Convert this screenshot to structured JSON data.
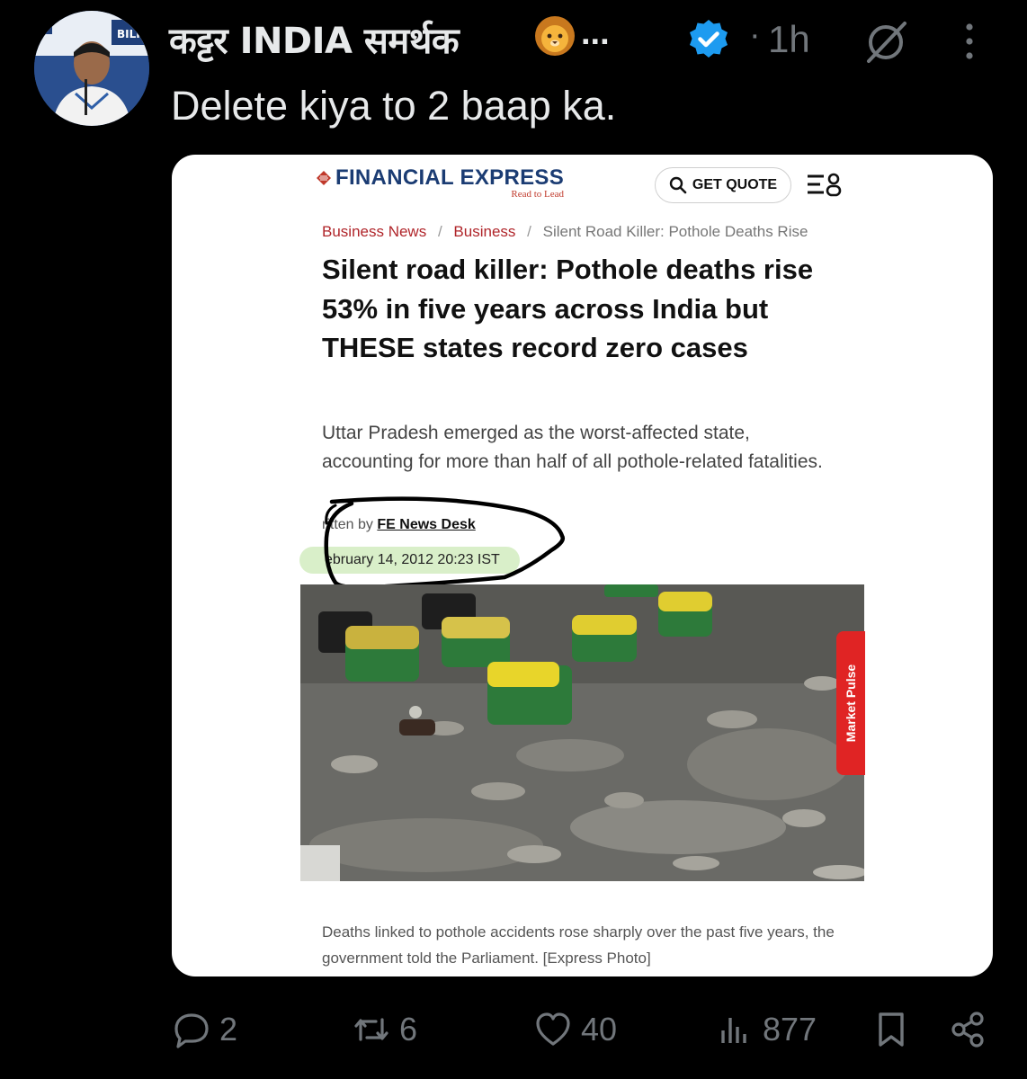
{
  "post": {
    "author_name": "कट्टर INDIA समर्थक",
    "name_truncation": "...",
    "separator": "·",
    "time_ago": "1h",
    "text": "Delete kiya to 2 baap ka."
  },
  "embedded_article": {
    "logo_name": "FINANCIAL EXPRESS",
    "logo_tagline": "Read to Lead",
    "get_quote_label": "GET QUOTE",
    "breadcrumbs": [
      "Business News",
      "Business",
      "Silent Road Killer: Pothole Deaths Rise"
    ],
    "breadcrumb_sep": "/",
    "headline": "Silent road killer: Pothole deaths rise 53% in five years across India but THESE states record zero cases",
    "summary": "Uttar Pradesh emerged as the worst-affected state, accounting for more than half of all pothole-related fatalities.",
    "byline_prefix": "ritten by",
    "author": "FE News Desk",
    "date": "ebruary 14, 2012 20:23 IST",
    "market_pulse": "Market Pulse",
    "caption": "Deaths linked to pothole accidents rose sharply over the past five years, the government told the Parliament. [Express Photo]"
  },
  "actions": {
    "replies": "2",
    "reposts": "6",
    "likes": "40",
    "views": "877"
  },
  "colors": {
    "background": "#000000",
    "text": "#e7e9ea",
    "muted": "#71767b",
    "verified": "#1d9bf0",
    "fe_blue": "#1b3c73",
    "fe_red": "#b0252a"
  }
}
